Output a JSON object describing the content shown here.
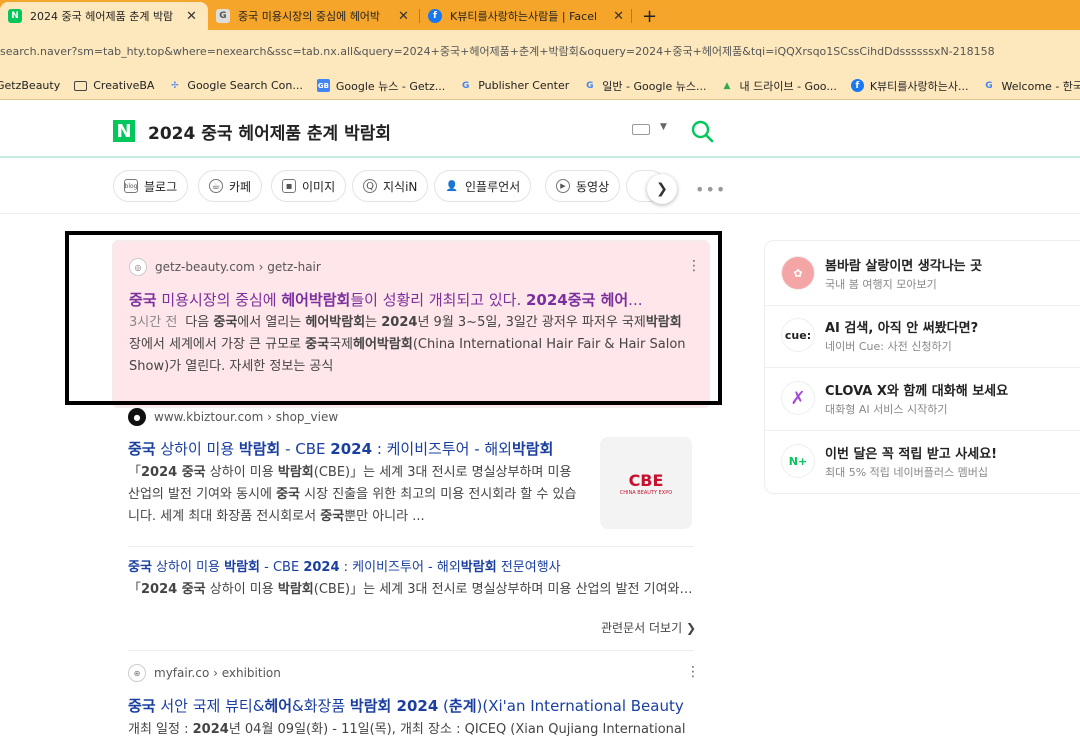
{
  "browser": {
    "tabs": [
      {
        "title": "2024 중국 헤어제품 춘계 박람",
        "favicon": "N",
        "favicon_color": "#03c75a",
        "active": true
      },
      {
        "title": "중국 미용시장의 중심에 헤어박",
        "favicon": "G",
        "favicon_color": "#888888",
        "active": false
      },
      {
        "title": "K뷰티를사랑하는사람들 | Facel",
        "favicon": "f",
        "favicon_color": "#1877f2",
        "active": false
      }
    ],
    "new_tab": "+",
    "address": "search.naver?sm=tab_hty.top&where=nexearch&ssc=tab.nx.all&query=2024+중국+헤어제품+춘계+박람회&oquery=2024+중국+헤어제품&tqi=iQQXrsqo1SCssCihdDdssssssxN-218158",
    "bookmarks": [
      {
        "label": "GetzBeauty",
        "icon": "folder-icon"
      },
      {
        "label": "CreativeBA",
        "icon": "folder-icon"
      },
      {
        "label": "Google Search Con...",
        "icon": "gsc-icon"
      },
      {
        "label": "Google 뉴스 - Getz...",
        "icon": "gnews-icon"
      },
      {
        "label": "Publisher Center",
        "icon": "google-icon"
      },
      {
        "label": "일반 - Google 뉴스...",
        "icon": "google-icon"
      },
      {
        "label": "내 드라이브 - Goo...",
        "icon": "drive-icon"
      },
      {
        "label": "K뷰티를사랑하는사...",
        "icon": "facebook-icon"
      },
      {
        "label": "Welcome - 한국인...",
        "icon": "google-icon"
      }
    ]
  },
  "search": {
    "logo": "N",
    "query": "2024 중국 헤어제품 춘계 박람회"
  },
  "filters": [
    {
      "label": "블로그",
      "icon": "blog-icon"
    },
    {
      "label": "카페",
      "icon": "cafe-icon"
    },
    {
      "label": "이미지",
      "icon": "image-icon"
    },
    {
      "label": "지식iN",
      "icon": "qna-icon"
    },
    {
      "label": "인플루언서",
      "icon": "person-icon"
    },
    {
      "label": "동영상",
      "icon": "play-icon"
    }
  ],
  "results": {
    "r1": {
      "source": "getz-beauty.com › getz-hair",
      "title_html": "<b>중국</b> 미용시장의 중심에 <b>헤어박람회</b>들이 성황리 개최되고 있다. <b>2024중국 헤어</b>...",
      "time": "3시간 전",
      "desc_html": "다음 <b>중국</b>에서 열리는 <b>헤어박람회</b>는 <b>2024</b>년 9월 3~5일, 3일간 광저우 파저우 국제<b>박람회</b>장에서 세계에서 가장 큰 규모로 <b>중국</b>국제<b>헤어박람회</b>(China International Hair Fair &amp; Hair Salon Show)가 열린다. 자세한 정보는 공식"
    },
    "r2": {
      "source": "www.kbiztour.com › shop_view",
      "title_html": "<b>중국</b> 상하이 미용 <b>박람회</b> - CBE <b>2024</b> : 케이비즈투어 - 해외<b>박람회</b>",
      "desc_html": "「<b>2024 중국</b> 상하이 미용 <b>박람회</b>(CBE)」는 세계 3대 전시로 명실상부하며 미용 산업의 발전 기여와 동시에 <b>중국</b> 시장 진출을 위한 최고의 미용 전시회라 할 수 있습니다. 세계 최대 화장품 전시회로서 <b>중국</b>뿐만 아니라 ...",
      "thumb_logo": "CBE",
      "thumb_sub": "CHINA BEAUTY EXPO",
      "sub_title_html": "<b>중국</b> 상하이 미용 <b>박람회</b> - CBE <b>2024</b> : 케이비즈투어 - 해외<b>박람회</b> 전문여행사",
      "sub_desc_html": "「<b>2024 중국</b> 상하이 미용 <b>박람회</b>(CBE)」는 세계 3대 전시로 명실상부하며 미용 산업의 발전 기여와 동시에 중국 시장 진출을",
      "related": "관련문서 더보기"
    },
    "r3": {
      "source": "myfair.co › exhibition",
      "title_html": "<b>중국</b> 서안 국제 뷰티&amp;<b>헤어</b>&amp;화장품 <b>박람회 2024</b> (<b>춘계</b>)(Xi'an International Beauty",
      "desc_html": "개최 일정 : <b>2024</b>년 04월 09일(화) - 11일(목), 개최 장소 : QICEQ (Xian Qujiang International"
    }
  },
  "sidebar": [
    {
      "title": "봄바람 살랑이면 생각나는 곳",
      "desc": "국내 봄 여행지 모아보기",
      "icon": "flower-icon",
      "color": "#f4a6a6"
    },
    {
      "title": "AI 검색, 아직 안 써봤다면?",
      "desc": "네이버 Cue: 사전 신청하기",
      "icon": "cue-icon",
      "label": "cue:",
      "color": "#222222"
    },
    {
      "title": "CLOVA X와 함께 대화해 보세요",
      "desc": "대화형 AI 서비스 시작하기",
      "icon": "clova-icon",
      "color": "#a34bd6"
    },
    {
      "title": "이번 달은 꼭 적립 받고 사세요!",
      "desc": "최대 5% 적립 네이버플러스 멤버십",
      "icon": "nplus-icon",
      "label": "N+",
      "color": "#03c75a"
    }
  ]
}
